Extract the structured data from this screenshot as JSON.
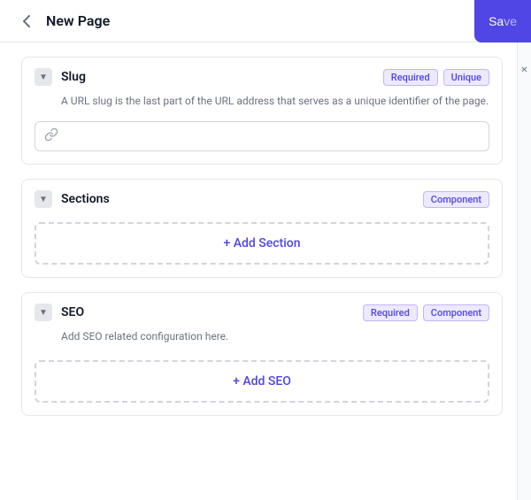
{
  "header": {
    "back_icon": "‹",
    "title": "New Page",
    "save_label": "Sa..."
  },
  "left_toggle": {
    "icon": "▼"
  },
  "right_toggle": {
    "close_icon": "✕"
  },
  "fields": [
    {
      "id": "slug",
      "name": "Slug",
      "description": "A URL slug is the last part of the URL address that serves as a unique identifier of the page.",
      "badges": [
        "Required",
        "Unique"
      ],
      "input_placeholder": "",
      "has_input": true,
      "has_add_button": false,
      "add_label": ""
    },
    {
      "id": "sections",
      "name": "Sections",
      "description": "",
      "badges": [
        "Component"
      ],
      "has_input": false,
      "has_add_button": true,
      "add_label": "+ Add Section"
    },
    {
      "id": "seo",
      "name": "SEO",
      "description": "Add SEO related configuration here.",
      "badges": [
        "Required",
        "Component"
      ],
      "has_input": false,
      "has_add_button": true,
      "add_label": "+ Add SEO"
    }
  ],
  "badge_classes": {
    "Required": "badge-required",
    "Unique": "badge-unique",
    "Component": "badge-component"
  }
}
